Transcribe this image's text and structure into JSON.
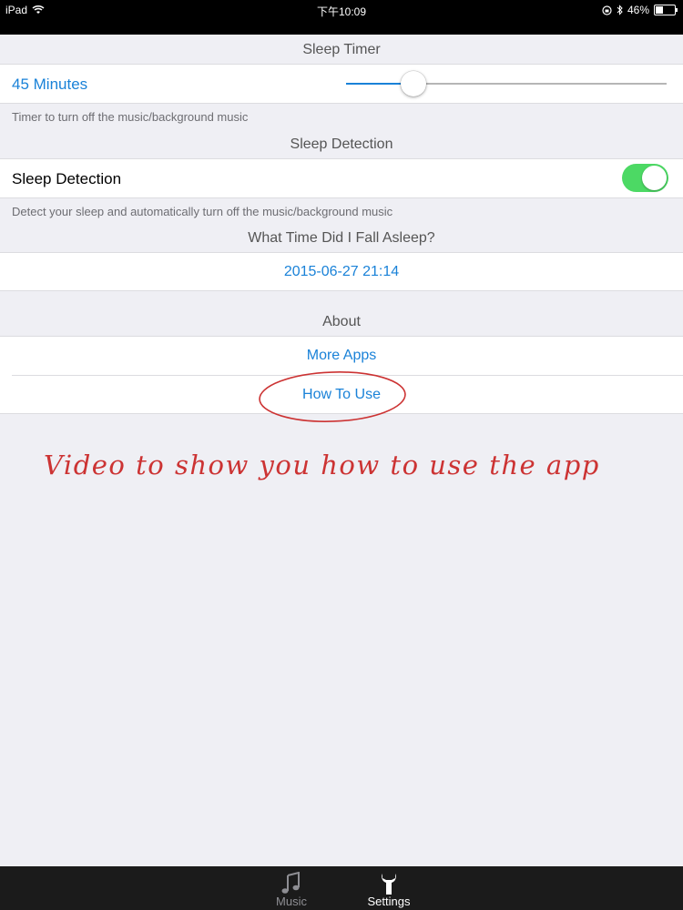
{
  "status_bar": {
    "device": "iPad",
    "time": "下午10:09",
    "battery": "46%",
    "battery_level": 0.46
  },
  "sleep_timer": {
    "header": "Sleep Timer",
    "value_label": "45 Minutes",
    "slider_value": 0.21,
    "footnote": "Timer to turn off the music/background music"
  },
  "sleep_detection": {
    "header": "Sleep Detection",
    "row_label": "Sleep Detection",
    "enabled": true,
    "footnote": "Detect your sleep and automatically turn off the music/background music"
  },
  "fall_asleep": {
    "header": "What Time Did I Fall Asleep?",
    "value": "2015-06-27 21:14"
  },
  "about": {
    "header": "About",
    "more_apps": "More Apps",
    "how_to_use": "How To Use"
  },
  "annotation": {
    "text": "Video to show you how to use the app",
    "color": "#cc3333"
  },
  "tab_bar": {
    "tabs": [
      {
        "label": "Music",
        "icon": "music-note-icon",
        "active": false
      },
      {
        "label": "Settings",
        "icon": "wrench-icon",
        "active": true
      }
    ]
  },
  "colors": {
    "accent": "#1a82d8",
    "toggle_on": "#4cd964",
    "background": "#efeff4"
  }
}
